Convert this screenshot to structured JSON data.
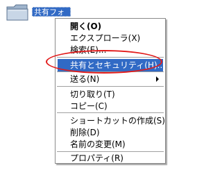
{
  "desktop": {
    "folder_icon": "folder-icon",
    "folder_label": "共有フォ"
  },
  "context_menu": {
    "open": "開く(O)",
    "explorer": "エクスプローラ(X)",
    "search": "検索(E)...",
    "sharing_security": "共有とセキュリティ(H)...",
    "send_to": "送る(N)",
    "cut": "切り取り(T)",
    "copy": "コピー(C)",
    "create_shortcut": "ショートカットの作成(S)",
    "delete": "削除(D)",
    "rename": "名前の変更(M)",
    "properties": "プロパティ(R)"
  },
  "colors": {
    "selection": "#316ac5",
    "annotation": "#e21b1b"
  }
}
